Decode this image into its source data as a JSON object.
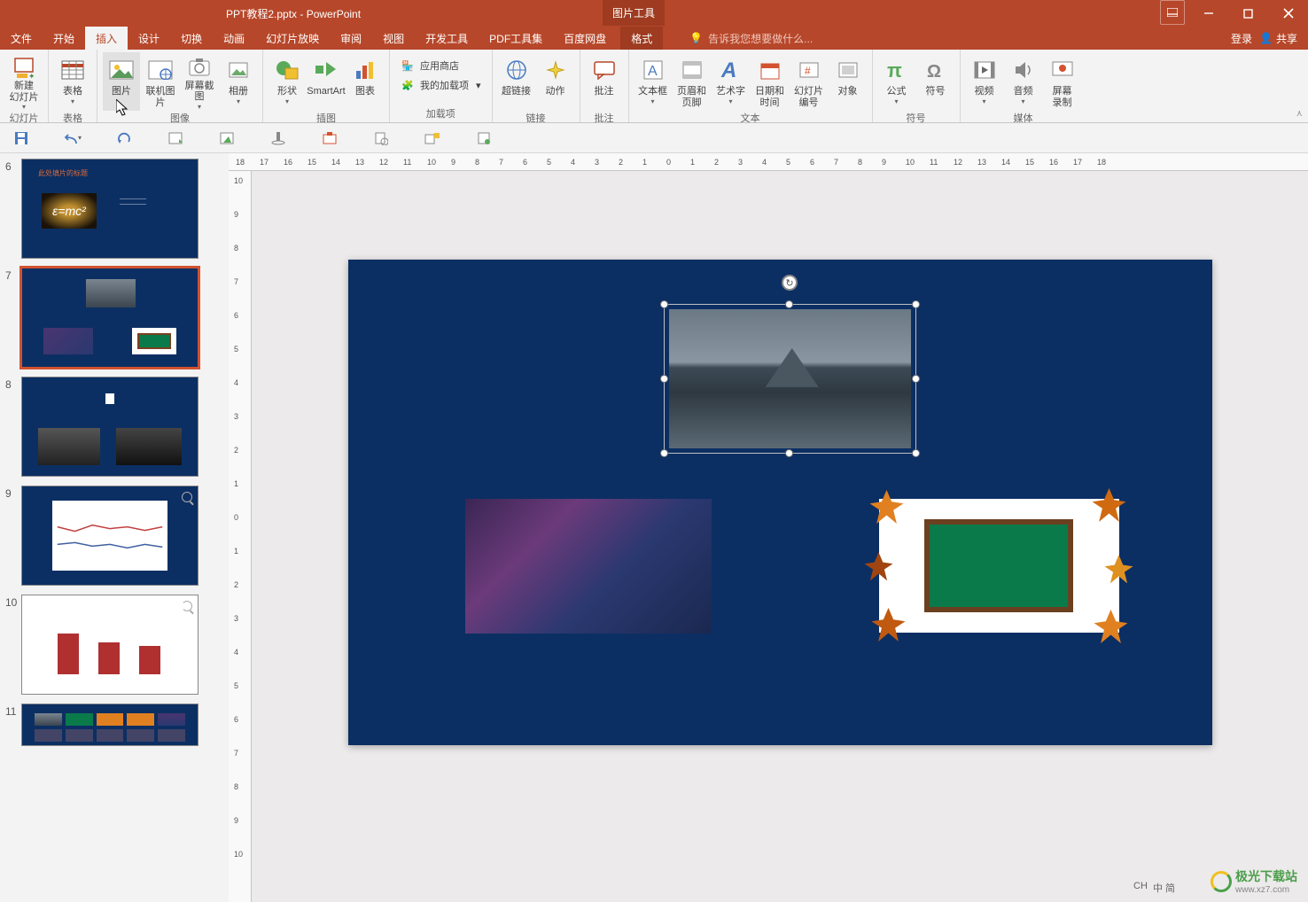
{
  "title": {
    "doc": "PPT教程2.pptx - PowerPoint",
    "contextual": "图片工具"
  },
  "tabs": {
    "file": "文件",
    "home": "开始",
    "insert": "插入",
    "design": "设计",
    "transitions": "切换",
    "animations": "动画",
    "slideshow": "幻灯片放映",
    "review": "审阅",
    "view": "视图",
    "developer": "开发工具",
    "pdf": "PDF工具集",
    "baidu": "百度网盘",
    "format": "格式"
  },
  "tellme": "告诉我您想要做什么...",
  "rightactions": {
    "signin": "登录",
    "share": "共享"
  },
  "ribbon": {
    "slides": {
      "new_slide": "新建\n幻灯片",
      "label": "幻灯片"
    },
    "tables": {
      "table": "表格",
      "label": "表格"
    },
    "images": {
      "picture": "图片",
      "online": "联机图片",
      "screenshot": "屏幕截图",
      "album": "相册",
      "label": "图像"
    },
    "illustrations": {
      "shapes": "形状",
      "smartart": "SmartArt",
      "chart": "图表",
      "label": "插图"
    },
    "addins": {
      "store": "应用商店",
      "myaddins": "我的加载项",
      "label": "加载项"
    },
    "links": {
      "hyperlink": "超链接",
      "action": "动作",
      "label": "链接"
    },
    "comments": {
      "comment": "批注",
      "label": "批注"
    },
    "text": {
      "textbox": "文本框",
      "headerfooter": "页眉和页脚",
      "wordart": "艺术字",
      "datetime": "日期和时间",
      "slidenum": "幻灯片\n编号",
      "object": "对象",
      "label": "文本"
    },
    "symbols": {
      "equation": "公式",
      "symbol": "符号",
      "label": "符号"
    },
    "media": {
      "video": "视频",
      "audio": "音频",
      "screenrec": "屏幕\n录制",
      "label": "媒体"
    }
  },
  "thumbs": {
    "6": {
      "num": "6",
      "title": "此处填片的标题",
      "formula": "ε=mc²"
    },
    "7": {
      "num": "7"
    },
    "8": {
      "num": "8"
    },
    "9": {
      "num": "9"
    },
    "10": {
      "num": "10"
    },
    "11": {
      "num": "11"
    }
  },
  "ruler_h": [
    "18",
    "17",
    "16",
    "15",
    "14",
    "13",
    "12",
    "11",
    "10",
    "9",
    "8",
    "7",
    "6",
    "5",
    "4",
    "3",
    "2",
    "1",
    "0",
    "1",
    "2",
    "3",
    "4",
    "5",
    "6",
    "7",
    "8",
    "9",
    "10",
    "11",
    "12",
    "13",
    "14",
    "15",
    "16",
    "17",
    "18"
  ],
  "ruler_v": [
    "10",
    "9",
    "8",
    "7",
    "6",
    "5",
    "4",
    "3",
    "2",
    "1",
    "0",
    "1",
    "2",
    "3",
    "4",
    "5",
    "6",
    "7",
    "8",
    "9",
    "10"
  ],
  "ime": {
    "lang": "CH",
    "ext": "中 简"
  },
  "watermark": {
    "text": "极光下载站",
    "url": "www.xz7.com"
  }
}
